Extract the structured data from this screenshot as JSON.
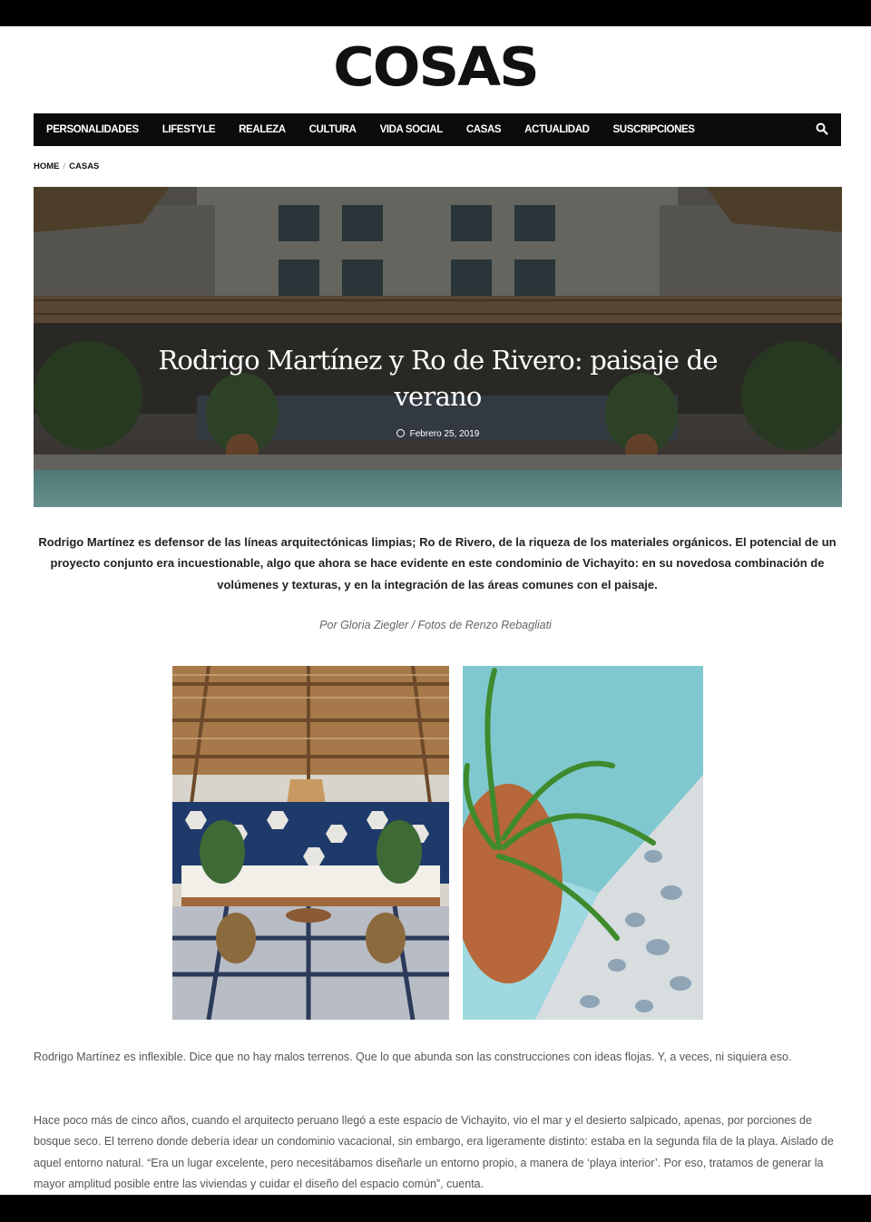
{
  "site": {
    "logo": "COSAS"
  },
  "nav": {
    "items": [
      "PERSONALIDADES",
      "LIFESTYLE",
      "REALEZA",
      "CULTURA",
      "VIDA SOCIAL",
      "CASAS",
      "ACTUALIDAD",
      "SUSCRIPCIONES"
    ],
    "search_icon": "search-icon"
  },
  "breadcrumb": {
    "home": "HOME",
    "current": "CASAS"
  },
  "article": {
    "title": "Rodrigo Martínez y Ro de Rivero: paisaje de verano",
    "date": "Febrero 25, 2019",
    "lead": "Rodrigo Martínez es defensor de las líneas arquitectónicas limpias; Ro de Rivero, de la riqueza de los materiales orgánicos. El potencial de un proyecto conjunto era incuestionable, algo que ahora se hace evidente en este condominio de Vichayito: en su novedosa combinación de volúmenes y texturas, y en la integración de las áreas comunes con el paisaje.",
    "byline": "Por Gloria Ziegler / Fotos de Renzo Rebagliati",
    "paragraphs": [
      "Rodrigo Martínez es inflexible. Dice que no hay malos terrenos. Que lo que abunda son las construcciones con ideas flojas. Y, a veces, ni siquiera eso.",
      "Hace poco más de cinco años, cuando el arquitecto peruano llegó a este espacio de Vichayito, vio el mar y el desierto salpicado, apenas, por porciones de bosque seco. El terreno donde debería idear un condominio vacacional, sin embargo, era ligeramente distinto: estaba en la segunda fila de la playa. Aislado de aquel entorno natural. “Era un lugar excelente, pero necesitábamos diseñarle un entorno propio, a manera de ‘playa interior’. Por eso, tratamos de generar la mayor amplitud posible entre las viviendas y cuidar el diseño del espacio común”, cuenta."
    ]
  },
  "colors": {
    "nav_bg": "#0b0b0b",
    "frame": "#000000",
    "pool": "#7fc8c9",
    "tile_blue": "#1d3a6b"
  }
}
